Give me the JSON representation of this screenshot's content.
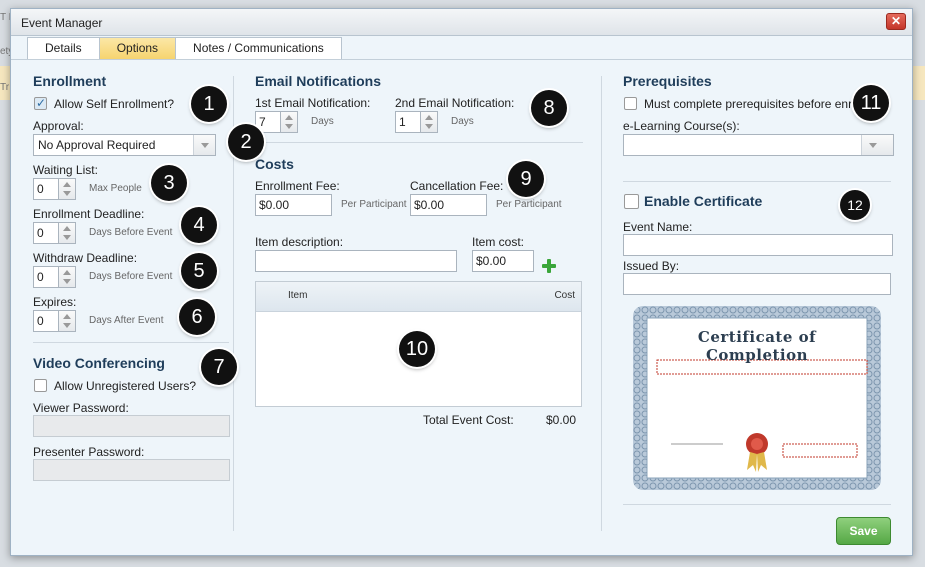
{
  "background": {
    "text_a": "T E",
    "text_b": "ety",
    "text_c": "Tr"
  },
  "window": {
    "title": "Event Manager",
    "close_glyph": "✕"
  },
  "tabs": [
    {
      "label": "Details",
      "active": false
    },
    {
      "label": "Options",
      "active": true
    },
    {
      "label": "Notes / Communications",
      "active": false
    }
  ],
  "enrollment": {
    "title": "Enrollment",
    "allow_self_enrollment": {
      "label": "Allow Self Enrollment?",
      "checked": true
    },
    "approval": {
      "label": "Approval:",
      "value": "No Approval Required"
    },
    "waiting_list": {
      "label": "Waiting List:",
      "value": "0",
      "unit": "Max People"
    },
    "enrollment_deadline": {
      "label": "Enrollment Deadline:",
      "value": "0",
      "unit": "Days Before Event"
    },
    "withdraw_deadline": {
      "label": "Withdraw Deadline:",
      "value": "0",
      "unit": "Days Before Event"
    },
    "expires": {
      "label": "Expires:",
      "value": "0",
      "unit": "Days After Event"
    }
  },
  "video_conferencing": {
    "title": "Video Conferencing",
    "allow_unregistered": {
      "label": "Allow Unregistered Users?",
      "checked": false
    },
    "viewer_password": {
      "label": "Viewer Password:",
      "value": ""
    },
    "presenter_password": {
      "label": "Presenter Password:",
      "value": ""
    }
  },
  "email_notifications": {
    "title": "Email Notifications",
    "first": {
      "label": "1st Email Notification:",
      "value": "7",
      "unit": "Days"
    },
    "second": {
      "label": "2nd Email Notification:",
      "value": "1",
      "unit": "Days"
    }
  },
  "costs": {
    "title": "Costs",
    "enrollment_fee": {
      "label": "Enrollment Fee:",
      "value": "$0.00",
      "unit": "Per Participant"
    },
    "cancellation_fee": {
      "label": "Cancellation Fee:",
      "value": "$0.00",
      "unit": "Per Participant"
    },
    "item_description": {
      "label": "Item description:",
      "value": ""
    },
    "item_cost": {
      "label": "Item cost:",
      "value": "$0.00"
    },
    "table": {
      "columns": [
        "Item",
        "Cost"
      ],
      "rows": []
    },
    "total": {
      "label": "Total Event Cost:",
      "value": "$0.00"
    }
  },
  "prerequisites": {
    "title": "Prerequisites",
    "must_complete": {
      "label": "Must complete prerequisites before enr",
      "checked": false
    },
    "elearning": {
      "label": "e-Learning Course(s):",
      "value": ""
    }
  },
  "certificate": {
    "enable": {
      "label": "Enable Certificate",
      "checked": false
    },
    "event_name": {
      "label": "Event Name:",
      "value": ""
    },
    "issued_by": {
      "label": "Issued By:",
      "value": ""
    },
    "preview_title": "Certificate of Completion"
  },
  "callouts": [
    "1",
    "2",
    "3",
    "4",
    "5",
    "6",
    "7",
    "8",
    "9",
    "10",
    "11",
    "12"
  ],
  "buttons": {
    "save": "Save"
  },
  "colors": {
    "accent": "#1f3d5a",
    "save_green": "#55a845",
    "tab_active": "#f6d46f",
    "close_red": "#c4362a"
  }
}
